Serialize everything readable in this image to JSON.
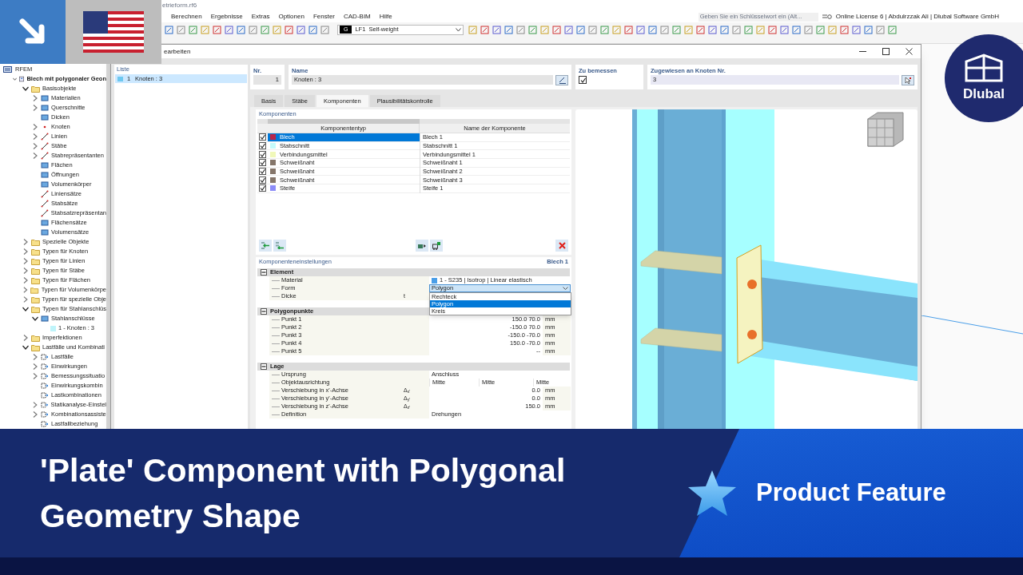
{
  "app": {
    "title": "etrieform.rf6",
    "menu": [
      "Berechnen",
      "Ergebnisse",
      "Extras",
      "Optionen",
      "Fenster",
      "CAD-BIM",
      "Hilfe"
    ],
    "search": {
      "placeholder": "Geben Sie ein Schlüsselwort ein (Alt..."
    },
    "license": "Online License 6 | Abdulrzzak Ali | Dlubal Software GmbH",
    "load_case": {
      "tag": "G",
      "number": "LF1",
      "name": "Self-weight"
    }
  },
  "navigator": {
    "root": "RFEM",
    "items": [
      {
        "label": "Blech mit polygonaler Geon",
        "kind": "model",
        "expanded": true,
        "children": [
          {
            "label": "Basisobjekte",
            "kind": "folder",
            "expanded": true,
            "children": [
              {
                "label": "Materialien",
                "kind": "object",
                "expanded": false
              },
              {
                "label": "Querschnitte",
                "kind": "object",
                "expanded": false
              },
              {
                "label": "Dicken",
                "kind": "object"
              },
              {
                "label": "Knoten",
                "kind": "point",
                "expanded": false
              },
              {
                "label": "Linien",
                "kind": "line",
                "expanded": false
              },
              {
                "label": "Stäbe",
                "kind": "line",
                "expanded": false
              },
              {
                "label": "Stabrepräsentanten",
                "kind": "line",
                "expanded": false
              },
              {
                "label": "Flächen",
                "kind": "object"
              },
              {
                "label": "Öffnungen",
                "kind": "object"
              },
              {
                "label": "Volumenkörper",
                "kind": "object"
              },
              {
                "label": "Liniensätze",
                "kind": "line"
              },
              {
                "label": "Stabsätze",
                "kind": "line"
              },
              {
                "label": "Stabsatzrepräsentan",
                "kind": "line"
              },
              {
                "label": "Flächensätze",
                "kind": "object"
              },
              {
                "label": "Volumensätze",
                "kind": "object"
              }
            ]
          },
          {
            "label": "Spezielle Objekte",
            "kind": "folder",
            "expanded": false
          },
          {
            "label": "Typen für Knoten",
            "kind": "folder",
            "expanded": false
          },
          {
            "label": "Typen für Linien",
            "kind": "folder",
            "expanded": false
          },
          {
            "label": "Typen für Stäbe",
            "kind": "folder",
            "expanded": false
          },
          {
            "label": "Typen für Flächen",
            "kind": "folder",
            "expanded": false
          },
          {
            "label": "Typen für Volumenkörpe",
            "kind": "folder",
            "expanded": false
          },
          {
            "label": "Typen für spezielle Obje",
            "kind": "folder",
            "expanded": false
          },
          {
            "label": "Typen für Stahlanschlüs",
            "kind": "folder",
            "expanded": true,
            "children": [
              {
                "label": "Stahlanschlüsse",
                "kind": "object",
                "expanded": true,
                "children": [
                  {
                    "label": "1 - Knoten : 3",
                    "kind": "connection"
                  }
                ]
              }
            ]
          },
          {
            "label": "Imperfektionen",
            "kind": "folder",
            "expanded": false
          },
          {
            "label": "Lastfälle und Kombinati",
            "kind": "folder",
            "expanded": true,
            "children": [
              {
                "label": "Lastfälle",
                "kind": "load",
                "expanded": false
              },
              {
                "label": "Einwirkungen",
                "kind": "load",
                "expanded": false
              },
              {
                "label": "Bemessungssituatio",
                "kind": "load",
                "expanded": false
              },
              {
                "label": "Einwirkungskombin",
                "kind": "load"
              },
              {
                "label": "Lastkombinationen",
                "kind": "load"
              },
              {
                "label": "Statikanalyse-Einstel",
                "kind": "load",
                "expanded": false
              },
              {
                "label": "Kombinationsassiste",
                "kind": "load",
                "expanded": false
              },
              {
                "label": "Lastfallbeziehung",
                "kind": "load"
              }
            ]
          }
        ]
      }
    ]
  },
  "dialog": {
    "title": "earbeiten",
    "list": {
      "title": "Liste",
      "items": [
        {
          "number": "1",
          "label": "Knoten : 3",
          "selected": true
        }
      ]
    },
    "header": {
      "number": {
        "label": "Nr.",
        "value": "1"
      },
      "name": {
        "label": "Name",
        "value": "Knoten : 3"
      },
      "design": {
        "label": "Zu bemessen",
        "checked": true
      },
      "nodes": {
        "label": "Zugewiesen an Knoten Nr.",
        "value": "3"
      }
    },
    "tabs": [
      {
        "label": "Basis",
        "selected": false
      },
      {
        "label": "Stäbe",
        "selected": false
      },
      {
        "label": "Komponenten",
        "selected": true
      },
      {
        "label": "Plausibilitätskontrolle",
        "selected": false
      }
    ],
    "components": {
      "title": "Komponenten",
      "columns": [
        "Komponententyp",
        "Name der Komponente"
      ],
      "rows": [
        {
          "type": "Blech",
          "name": "Blech 1",
          "color": "#b8264a",
          "checked": true,
          "selected": true
        },
        {
          "type": "Stabschnitt",
          "name": "Stabschnitt 1",
          "color": "#c4fafa",
          "checked": true,
          "selected": false
        },
        {
          "type": "Verbindungsmittel",
          "name": "Verbindungsmittel 1",
          "color": "#f0f8b8",
          "checked": true,
          "selected": false
        },
        {
          "type": "Schweißnaht",
          "name": "Schweißnaht 1",
          "color": "#85766a",
          "checked": true,
          "selected": false
        },
        {
          "type": "Schweißnaht",
          "name": "Schweißnaht 2",
          "color": "#85766a",
          "checked": true,
          "selected": false
        },
        {
          "type": "Schweißnaht",
          "name": "Schweißnaht 3",
          "color": "#85766a",
          "checked": true,
          "selected": false
        },
        {
          "type": "Steife",
          "name": "Steife 1",
          "color": "#8c8cf8",
          "checked": true,
          "selected": false
        }
      ]
    },
    "settings": {
      "title": "Komponenteneinstellungen",
      "subject": "Blech 1",
      "groups": [
        {
          "label": "Element",
          "expanded": true,
          "rows": [
            {
              "kind": "material",
              "label": "Material",
              "value": "1 - S235 | Isotrop | Linear elastisch",
              "color": "#4a9ee8"
            },
            {
              "kind": "dropdown",
              "label": "Form",
              "value": "Polygon",
              "open": true,
              "options": [
                {
                  "label": "Rechteck",
                  "selected": false
                },
                {
                  "label": "Polygon",
                  "selected": true
                },
                {
                  "label": "Kreis",
                  "selected": false
                }
              ]
            },
            {
              "kind": "symbol",
              "label": "Dicke",
              "symbol": "t"
            }
          ]
        },
        {
          "label": "Polygonpunkte",
          "expanded": true,
          "rows": [
            {
              "kind": "number",
              "label": "Punkt 1",
              "value": "150.0 70.0",
              "unit": "mm"
            },
            {
              "kind": "number",
              "label": "Punkt 2",
              "value": "-150.0 70.0",
              "unit": "mm"
            },
            {
              "kind": "number",
              "label": "Punkt 3",
              "value": "-150.0 -70.0",
              "unit": "mm"
            },
            {
              "kind": "number",
              "label": "Punkt 4",
              "value": "150.0 -70.0",
              "unit": "mm"
            },
            {
              "kind": "number",
              "label": "Punkt 5",
              "value": "--",
              "unit": "mm"
            }
          ]
        },
        {
          "label": "Lage",
          "expanded": true,
          "rows": [
            {
              "kind": "text",
              "label": "Ursprung",
              "value": "Anschluss"
            },
            {
              "kind": "triple",
              "label": "Objektausrichtung",
              "values": [
                "Mitte",
                "Mitte",
                "Mitte"
              ]
            },
            {
              "kind": "number",
              "label": "Verschiebung in x'-Achse",
              "symbol": "Δ$_{x'}$",
              "value": "0.0",
              "unit": "mm"
            },
            {
              "kind": "number",
              "label": "Verschiebung in y'-Achse",
              "symbol": "Δ$_{y'}$",
              "value": "0.0",
              "unit": "mm"
            },
            {
              "kind": "number",
              "label": "Verschiebung in z'-Achse",
              "symbol": "Δ$_{z'}$",
              "value": "150.0",
              "unit": "mm"
            },
            {
              "kind": "text",
              "label": "Definition",
              "value": "Drehungen"
            }
          ]
        }
      ]
    }
  },
  "logo": {
    "text": "Dlubal"
  },
  "banner": {
    "title": "'Plate' Component with Polygonal Geometry Shape",
    "tag": "Product Feature"
  }
}
